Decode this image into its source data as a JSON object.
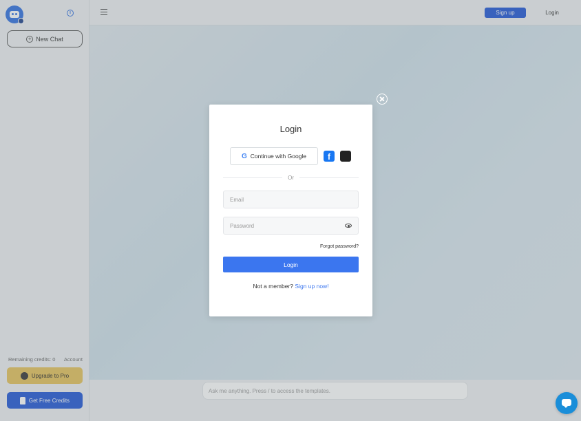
{
  "sidebar": {
    "new_chat_label": "New Chat",
    "remaining_credits": "Remaining credits: 0",
    "account_label": "Account",
    "upgrade_label": "Upgrade to Pro",
    "free_credits_label": "Get Free Credits"
  },
  "topbar": {
    "signup_label": "Sign up",
    "login_label": "Login"
  },
  "composer": {
    "placeholder": "Ask me anything. Press / to access the templates."
  },
  "login_modal": {
    "title": "Login",
    "google_label": "Continue with Google",
    "google_icon": "G",
    "facebook_icon": "f",
    "apple_icon": "",
    "divider_text": "Or",
    "email_placeholder": "Email",
    "password_placeholder": "Password",
    "forgot_password": "Forgot password?",
    "submit_label": "Login",
    "not_member_text": "Not a member?",
    "signup_link": "Sign up now!"
  },
  "colors": {
    "primary": "#3b76ef",
    "brand_blue": "#1f55d6",
    "upgrade_gold": "#e6c25a",
    "chat_bubble": "#1a8ed9"
  }
}
